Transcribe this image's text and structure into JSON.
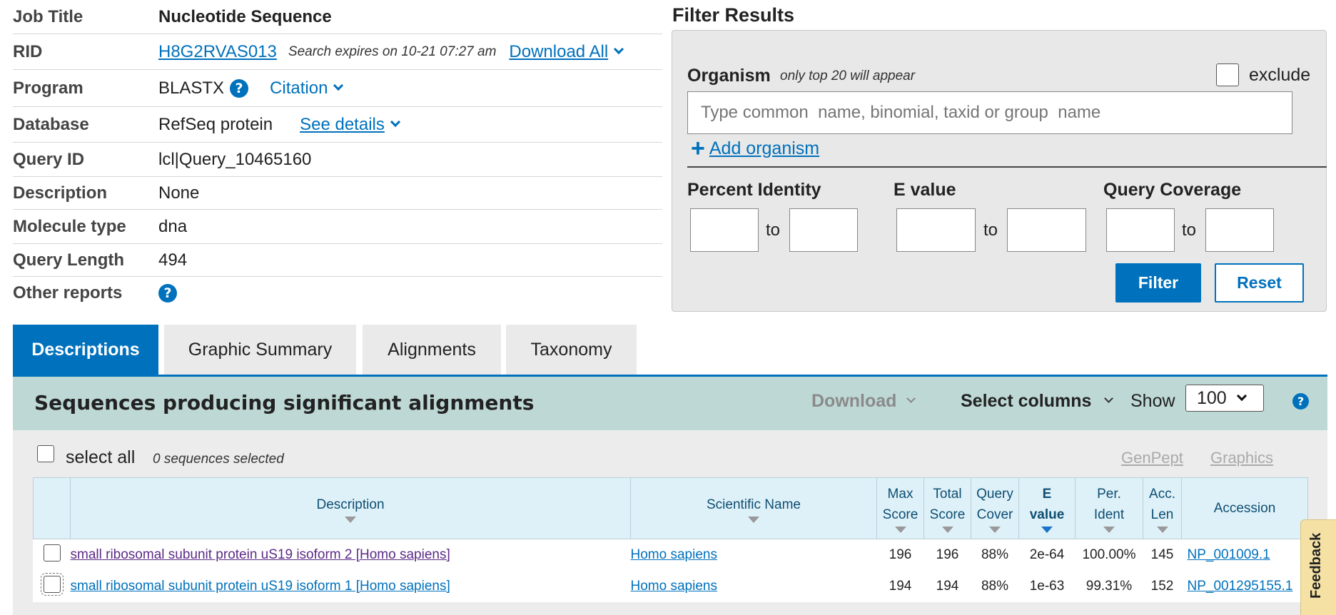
{
  "job": {
    "job_title_label": "Job Title",
    "job_title": "Nucleotide Sequence",
    "rid_label": "RID",
    "rid": "H8G2RVAS013",
    "expires": "Search expires on 10-21 07:27 am",
    "download_all": "Download All",
    "program_label": "Program",
    "program": "BLASTX",
    "citation": "Citation",
    "database_label": "Database",
    "database": "RefSeq protein",
    "see_details": "See details",
    "query_id_label": "Query ID",
    "query_id": "lcl|Query_10465160",
    "description_label": "Description",
    "description": "None",
    "molecule_type_label": "Molecule type",
    "molecule_type": "dna",
    "query_length_label": "Query Length",
    "query_length": "494",
    "other_reports_label": "Other reports"
  },
  "filter": {
    "title": "Filter Results",
    "organism_label": "Organism",
    "organism_hint": "only top 20 will appear",
    "exclude_label": "exclude",
    "organism_placeholder": "Type common  name, binomial, taxid or group  name",
    "add_organism": "Add organism",
    "percent_identity_label": "Percent Identity",
    "evalue_label": "E value",
    "query_coverage_label": "Query Coverage",
    "to": "to",
    "filter_button": "Filter",
    "reset_button": "Reset"
  },
  "tabs": [
    {
      "label": "Descriptions",
      "active": true
    },
    {
      "label": "Graphic Summary",
      "active": false
    },
    {
      "label": "Alignments",
      "active": false
    },
    {
      "label": "Taxonomy",
      "active": false
    }
  ],
  "results": {
    "title": "Sequences producing significant alignments",
    "download": "Download",
    "select_columns": "Select columns",
    "show_label": "Show",
    "show_value": "100",
    "select_all": "select all",
    "selected_count": "0 sequences selected",
    "genpept": "GenPept",
    "graphics": "Graphics",
    "columns": {
      "description": "Description",
      "scientific_name": "Scientific Name",
      "max_score_1": "Max",
      "max_score_2": "Score",
      "total_score_1": "Total",
      "total_score_2": "Score",
      "query_cover_1": "Query",
      "query_cover_2": "Cover",
      "evalue_1": "E",
      "evalue_2": "value",
      "per_ident_1": "Per.",
      "per_ident_2": "Ident",
      "acc_len_1": "Acc.",
      "acc_len_2": "Len",
      "accession": "Accession"
    },
    "rows": [
      {
        "description": "small ribosomal subunit protein uS19 isoform 2 [Homo sapiens]",
        "scientific_name": "Homo sapiens",
        "max_score": "196",
        "total_score": "196",
        "query_cover": "88%",
        "evalue": "2e-64",
        "per_ident": "100.00%",
        "acc_len": "145",
        "accession": "NP_001009.1"
      },
      {
        "description": "small ribosomal subunit protein uS19 isoform 1 [Homo sapiens]",
        "scientific_name": "Homo sapiens",
        "max_score": "194",
        "total_score": "194",
        "query_cover": "88%",
        "evalue": "1e-63",
        "per_ident": "99.31%",
        "acc_len": "152",
        "accession": "NP_001295155.1"
      }
    ]
  },
  "feedback": "Feedback",
  "colors": {
    "accent": "#0071bc",
    "band": "#bed9d5",
    "header": "#dff1f8"
  }
}
